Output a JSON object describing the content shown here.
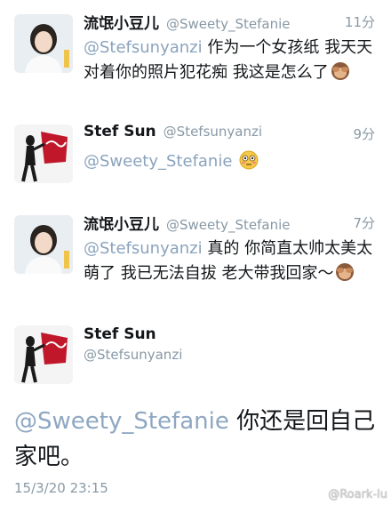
{
  "tweets": [
    {
      "name": "流氓小豆儿",
      "handle": "@Sweety_Stefanie",
      "time": "11分",
      "mention": "@Stefsunyanzi",
      "text": " 作为一个女孩纸 我天天对着你的照片犯花痴 我这是怎么了",
      "emoji": "see-no-evil-monkey-icon"
    },
    {
      "name": "Stef Sun",
      "handle": "@Stefsunyanzi",
      "time": "9分",
      "mention": "@Sweety_Stefanie",
      "text": " ",
      "emoji": "flushed-face-icon"
    },
    {
      "name": "流氓小豆儿",
      "handle": "@Sweety_Stefanie",
      "time": "7分",
      "mention": "@Stefsunyanzi",
      "text": " 真的 你简直太帅太美太萌了 我已无法自拔 老大带我回家～",
      "emoji": "see-no-evil-monkey-icon"
    }
  ],
  "detail": {
    "name": "Stef Sun",
    "handle": "@Stefsunyanzi",
    "mention": "@Sweety_Stefanie",
    "text": " 你还是回自己家吧。",
    "date": "15/3/20 23:15"
  },
  "watermark": "@Roark-lu",
  "colors": {
    "mention": "#8aa3bd",
    "meta_gray": "#8899a6",
    "divider": "#e1e8ed"
  }
}
